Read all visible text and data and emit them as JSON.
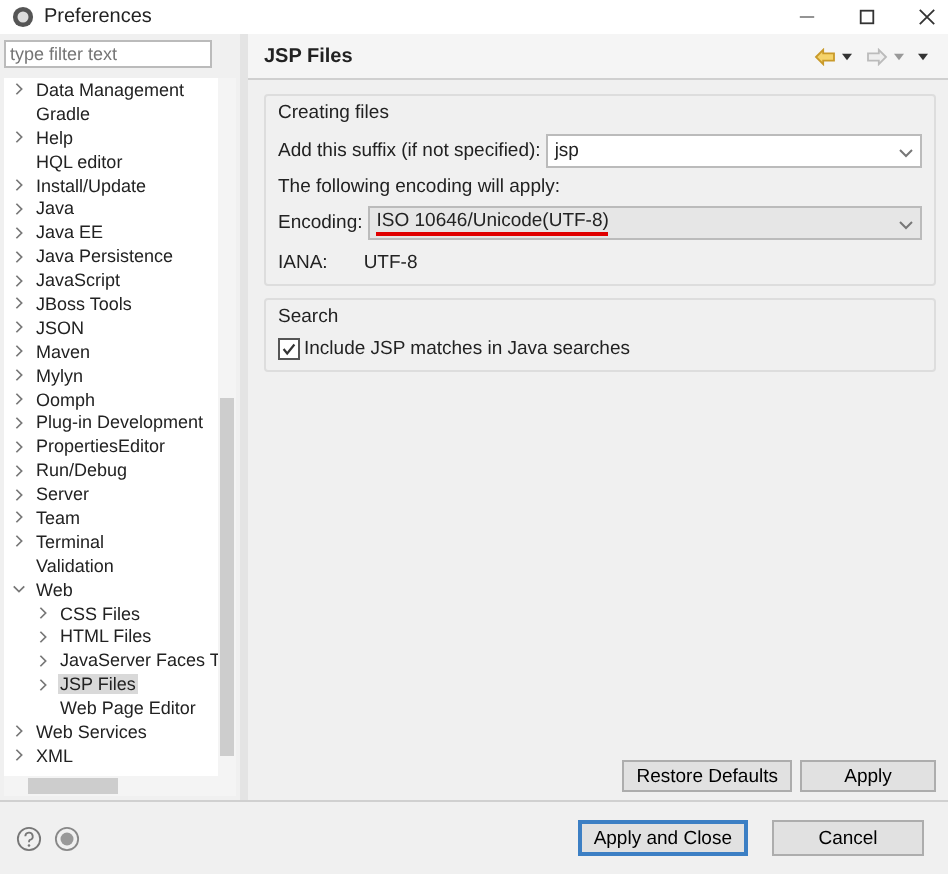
{
  "window": {
    "title": "Preferences"
  },
  "filter": {
    "placeholder": "type filter text"
  },
  "tree": [
    {
      "label": "Data Management",
      "kind": "branch",
      "expanded": false,
      "selected": false
    },
    {
      "label": "Gradle",
      "kind": "leaf",
      "selected": false
    },
    {
      "label": "Help",
      "kind": "branch",
      "expanded": false,
      "selected": false
    },
    {
      "label": "HQL editor",
      "kind": "leaf",
      "selected": false
    },
    {
      "label": "Install/Update",
      "kind": "branch",
      "expanded": false,
      "selected": false
    },
    {
      "label": "Java",
      "kind": "branch",
      "expanded": false,
      "selected": false
    },
    {
      "label": "Java EE",
      "kind": "branch",
      "expanded": false,
      "selected": false
    },
    {
      "label": "Java Persistence",
      "kind": "branch",
      "expanded": false,
      "selected": false
    },
    {
      "label": "JavaScript",
      "kind": "branch",
      "expanded": false,
      "selected": false
    },
    {
      "label": "JBoss Tools",
      "kind": "branch",
      "expanded": false,
      "selected": false
    },
    {
      "label": "JSON",
      "kind": "branch",
      "expanded": false,
      "selected": false
    },
    {
      "label": "Maven",
      "kind": "branch",
      "expanded": false,
      "selected": false
    },
    {
      "label": "Mylyn",
      "kind": "branch",
      "expanded": false,
      "selected": false
    },
    {
      "label": "Oomph",
      "kind": "branch",
      "expanded": false,
      "selected": false
    },
    {
      "label": "Plug-in Development",
      "kind": "branch",
      "expanded": false,
      "selected": false
    },
    {
      "label": "PropertiesEditor",
      "kind": "branch",
      "expanded": false,
      "selected": false
    },
    {
      "label": "Run/Debug",
      "kind": "branch",
      "expanded": false,
      "selected": false
    },
    {
      "label": "Server",
      "kind": "branch",
      "expanded": false,
      "selected": false
    },
    {
      "label": "Team",
      "kind": "branch",
      "expanded": false,
      "selected": false
    },
    {
      "label": "Terminal",
      "kind": "branch",
      "expanded": false,
      "selected": false
    },
    {
      "label": "Validation",
      "kind": "leaf",
      "selected": false
    },
    {
      "label": "Web",
      "kind": "branch",
      "expanded": true,
      "selected": false,
      "children": [
        {
          "label": "CSS Files",
          "kind": "branch",
          "expanded": false,
          "selected": false
        },
        {
          "label": "HTML Files",
          "kind": "branch",
          "expanded": false,
          "selected": false
        },
        {
          "label": "JavaServer Faces T",
          "kind": "branch",
          "expanded": false,
          "selected": false
        },
        {
          "label": "JSP Files",
          "kind": "branch",
          "expanded": false,
          "selected": true
        },
        {
          "label": "Web Page Editor",
          "kind": "leaf",
          "selected": false
        }
      ]
    },
    {
      "label": "Web Services",
      "kind": "branch",
      "expanded": false,
      "selected": false
    },
    {
      "label": "XML",
      "kind": "branch",
      "expanded": false,
      "selected": false
    }
  ],
  "page": {
    "title": "JSP Files",
    "creating": {
      "title": "Creating files",
      "suffix_label": "Add this suffix (if not specified):",
      "suffix_value": "jsp",
      "encoding_note": "The following encoding will apply:",
      "encoding_label": "Encoding:",
      "encoding_value": "ISO 10646/Unicode(UTF-8)",
      "iana_label": "IANA:",
      "iana_value": "UTF-8"
    },
    "search": {
      "title": "Search",
      "checkbox": {
        "label": "Include JSP matches in Java searches",
        "checked": true
      }
    },
    "buttons": [
      "Restore Defaults",
      "Apply"
    ]
  },
  "footer_buttons": [
    {
      "label": "Apply and Close",
      "default": true
    },
    {
      "label": "Cancel",
      "default": false
    }
  ]
}
